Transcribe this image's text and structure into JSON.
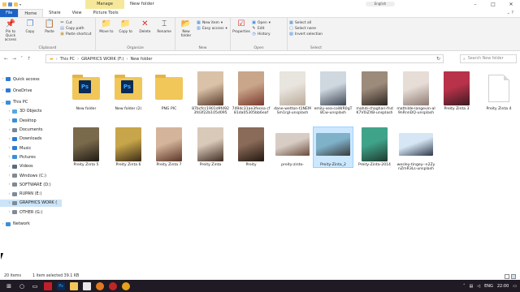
{
  "window": {
    "title": "New folder",
    "contextual_tab": "Manage",
    "language_indicator": "English"
  },
  "tabs": [
    {
      "label": "File"
    },
    {
      "label": "Home"
    },
    {
      "label": "Share"
    },
    {
      "label": "View"
    },
    {
      "label": "Picture Tools"
    }
  ],
  "ribbon": {
    "clipboard": {
      "pin_label": "Pin to Quick access",
      "copy_label": "Copy",
      "paste_label": "Paste",
      "cut_label": "Cut",
      "copy_path_label": "Copy path",
      "paste_shortcut_label": "Paste shortcut",
      "group_label": "Clipboard"
    },
    "organize": {
      "move_to_label": "Move to",
      "copy_to_label": "Copy to",
      "delete_label": "Delete",
      "rename_label": "Rename",
      "group_label": "Organize"
    },
    "new": {
      "new_folder_label": "New folder",
      "new_item_label": "New item",
      "easy_access_label": "Easy access",
      "group_label": "New"
    },
    "open": {
      "properties_label": "Properties",
      "open_label": "Open",
      "edit_label": "Edit",
      "history_label": "History",
      "group_label": "Open"
    },
    "select": {
      "select_all_label": "Select all",
      "select_none_label": "Select none",
      "invert_label": "Invert selection",
      "group_label": "Select"
    }
  },
  "address": {
    "crumbs": [
      "This PC",
      "GRAPHICS WORK (F:)",
      "New folder"
    ],
    "search_placeholder": "Search New folder"
  },
  "nav": {
    "items": [
      {
        "label": "Quick access",
        "icon": "star-icon",
        "color": "#2b7bd6",
        "indent": 0
      },
      {
        "label": "OneDrive",
        "icon": "cloud-icon",
        "color": "#2b7bd6",
        "indent": 0
      },
      {
        "label": "This PC",
        "icon": "computer-icon",
        "color": "#3a8fd8",
        "indent": 0
      },
      {
        "label": "3D Objects",
        "icon": "cube-icon",
        "color": "#56a6e3",
        "indent": 1
      },
      {
        "label": "Desktop",
        "icon": "desktop-icon",
        "color": "#3a8fd8",
        "indent": 1
      },
      {
        "label": "Documents",
        "icon": "documents-icon",
        "color": "#7a8699",
        "indent": 1
      },
      {
        "label": "Downloads",
        "icon": "download-icon",
        "color": "#2b7bd6",
        "indent": 1
      },
      {
        "label": "Music",
        "icon": "music-icon",
        "color": "#2b7bd6",
        "indent": 1
      },
      {
        "label": "Pictures",
        "icon": "pictures-icon",
        "color": "#3a8fd8",
        "indent": 1
      },
      {
        "label": "Videos",
        "icon": "video-icon",
        "color": "#5b6b80",
        "indent": 1
      },
      {
        "label": "Windows (C:)",
        "icon": "drive-icon",
        "color": "#7f8a96",
        "indent": 1
      },
      {
        "label": "SOFTWARE (D:)",
        "icon": "drive-icon",
        "color": "#7f8a96",
        "indent": 1
      },
      {
        "label": "RUPAN (E:)",
        "icon": "drive-icon",
        "color": "#7f8a96",
        "indent": 1
      },
      {
        "label": "GRAPHICS WORK (",
        "icon": "drive-icon",
        "color": "#7f8a96",
        "indent": 1
      },
      {
        "label": "OTHER (G:)",
        "icon": "drive-icon",
        "color": "#7f8a96",
        "indent": 1
      },
      {
        "label": "Network",
        "icon": "network-icon",
        "color": "#3a8fd8",
        "indent": 0
      }
    ]
  },
  "files": [
    {
      "name": "New folder",
      "kind": "folder-ps"
    },
    {
      "name": "New folder (2)",
      "kind": "folder-ps"
    },
    {
      "name": "PNG PIC",
      "kind": "folder"
    },
    {
      "name": "87bcfcc1901d9fd923fd3f22b105d095",
      "kind": "photo",
      "colors": [
        "#d9c2a8",
        "#5a3b2c"
      ]
    },
    {
      "name": "749dc31ae3fecea cf81da05305bb6eaf",
      "kind": "photo",
      "colors": [
        "#c9a58a",
        "#7b3a2e"
      ]
    },
    {
      "name": "dane-wetton-t1NEMSm1rgI-unsplash",
      "kind": "photo",
      "colors": [
        "#e8e4de",
        "#b9a998"
      ]
    },
    {
      "name": "emily-sea-coiWR0gT8Cw-unsplash",
      "kind": "photo",
      "colors": [
        "#cfd7df",
        "#3d4654"
      ]
    },
    {
      "name": "mahdi-chaghari-fndK7V0iZXB-unsplash",
      "kind": "photo",
      "colors": [
        "#9c8a7a",
        "#2d2620"
      ]
    },
    {
      "name": "mathilde-langevin-al9nRnnDQ-unsplash",
      "kind": "photo",
      "colors": [
        "#e6ddd6",
        "#8d7a72"
      ]
    },
    {
      "name": "Preity Zinta 3",
      "kind": "photo",
      "colors": [
        "#b8324a",
        "#3b1a22"
      ]
    },
    {
      "name": "Preity Zinta 4",
      "kind": "doc"
    },
    {
      "name": "Preity Zinta 5",
      "kind": "photo",
      "colors": [
        "#7a6a4c",
        "#1f1a14"
      ]
    },
    {
      "name": "Preity Zinta 6",
      "kind": "photo",
      "colors": [
        "#c7a54a",
        "#3c2c18"
      ]
    },
    {
      "name": "Preity Zinta 7",
      "kind": "photo",
      "colors": [
        "#d4b49a",
        "#5a3426"
      ]
    },
    {
      "name": "Preity Zinta",
      "kind": "photo",
      "colors": [
        "#d9c9b9",
        "#3e2a22"
      ]
    },
    {
      "name": "Preity",
      "kind": "photo",
      "colors": [
        "#8a6a58",
        "#22170f"
      ]
    },
    {
      "name": "preity-zinta-",
      "kind": "photo-short",
      "colors": [
        "#d8cdc5",
        "#6b4a3a"
      ]
    },
    {
      "name": "Preity-Zinta_2",
      "kind": "photo-short",
      "colors": [
        "#7fb1c9",
        "#3a3a3a"
      ],
      "selected": true
    },
    {
      "name": "Preity-Zinta-2014",
      "kind": "photo",
      "colors": [
        "#3fa38a",
        "#1f3a2e"
      ]
    },
    {
      "name": "wesley-tingey--n2ZynZmR3Ls-unsplash",
      "kind": "photo-short",
      "colors": [
        "#d6e6f4",
        "#2e3848"
      ]
    }
  ],
  "status": {
    "count": "20 items",
    "selection": "1 item selected  39.1 KB"
  },
  "taskbar": {
    "lang": "ENG",
    "time": "22:00"
  }
}
